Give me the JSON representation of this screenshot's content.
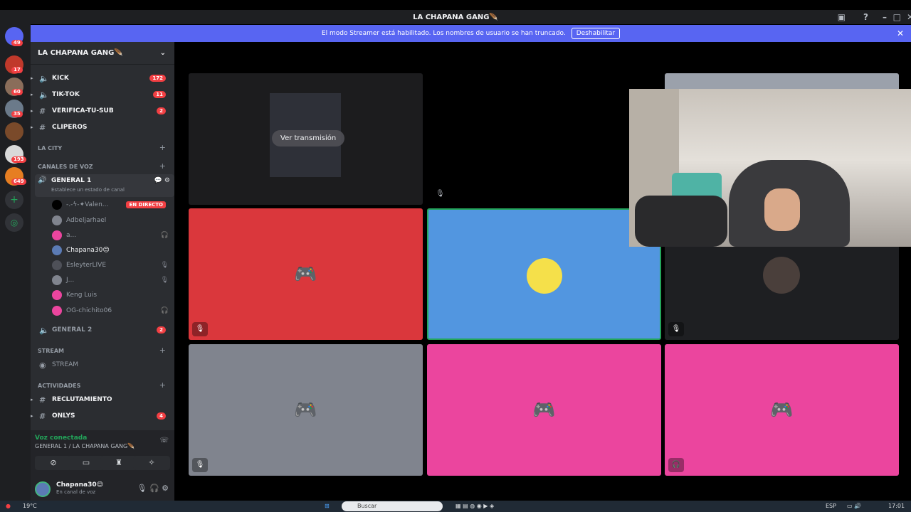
{
  "window": {
    "title": "LA CHAPANA GANG🪶"
  },
  "banner": {
    "text": "El modo Streamer está habilitado. Los nombres de usuario se han truncado.",
    "button": "Deshabilitar"
  },
  "guilds": [
    {
      "badge": "49"
    },
    {
      "badge": "17"
    },
    {
      "badge": "60"
    },
    {
      "badge": "35"
    },
    {
      "badge": ""
    },
    {
      "badge": "193"
    },
    {
      "badge": "649"
    }
  ],
  "server": {
    "name": "LA CHAPANA GANG🪶"
  },
  "channels": [
    {
      "icon": "speaker-icon",
      "label": "KICK",
      "badge": "172"
    },
    {
      "icon": "speaker-icon",
      "label": "TIK-TOK",
      "badge": "11"
    },
    {
      "icon": "hash-icon",
      "label": "VERIFICA-TU-SUB",
      "badge": "2"
    },
    {
      "icon": "hash-icon",
      "label": "CLIPEROS",
      "badge": ""
    }
  ],
  "categories": {
    "city": "LA CITY",
    "voice": "CANALES DE VOZ",
    "stream": "STREAM",
    "activities": "ACTIVIDADES"
  },
  "voice_channel": {
    "name": "GENERAL 1",
    "status": "Establece un estado de canal"
  },
  "voice_users": [
    {
      "name": "-.-ϟ-✦Valen...",
      "live": "EN DIRECTO",
      "color": "#000000"
    },
    {
      "name": "Adbeljarhael",
      "live": "",
      "color": "#80848e"
    },
    {
      "name": "a...",
      "live": "",
      "color": "#eb459e"
    },
    {
      "name": "Chapana30😊",
      "live": "",
      "color": "#5b7bb5"
    },
    {
      "name": "EsleyterLIVE",
      "live": "",
      "color": "#4e5058"
    },
    {
      "name": "J...",
      "live": "",
      "color": "#80848e"
    },
    {
      "name": "Keng Luis",
      "live": "",
      "color": "#eb459e"
    },
    {
      "name": "OG-chichito06",
      "live": "",
      "color": "#eb459e"
    }
  ],
  "general2": {
    "label": "GENERAL 2",
    "badge": "2"
  },
  "stream_channel": {
    "label": "STREAM"
  },
  "activity_channels": [
    {
      "label": "RECLUTAMIENTO",
      "badge": ""
    },
    {
      "label": "ONLYS",
      "badge": "4"
    }
  ],
  "voice_panel": {
    "status": "Voz conectada",
    "channel": "GENERAL 1 / LA CHAPANA GANG🪶"
  },
  "user": {
    "name": "Chapana30😊",
    "status": "En canal de voz"
  },
  "stage": {
    "watch_label": "Ver transmisión",
    "tile_colors": [
      "#da373c",
      "#5296e0",
      "#80848e",
      "#eb459e",
      "#eb459e"
    ]
  },
  "taskbar": {
    "weather": "19°C",
    "search": "Buscar",
    "lang": "ESP",
    "time": "17:01"
  }
}
